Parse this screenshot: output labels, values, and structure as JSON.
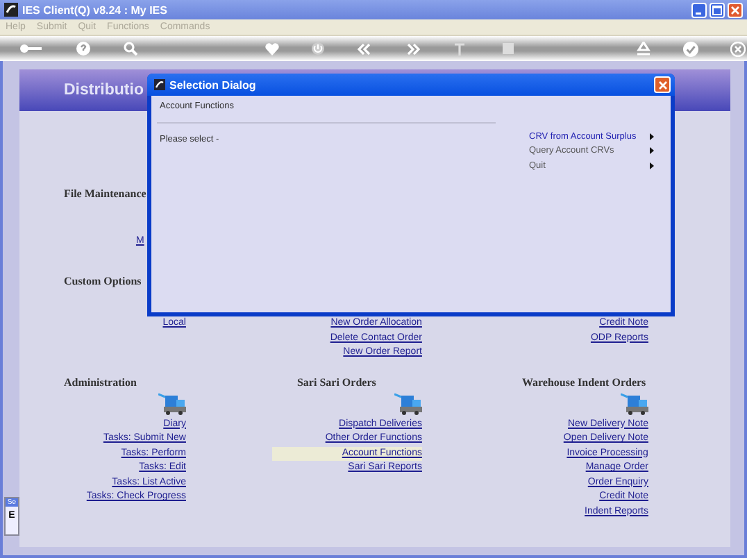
{
  "window": {
    "title": "IES Client(Q) v8.24 : My IES"
  },
  "menu": [
    {
      "label": "Help",
      "disabled": true
    },
    {
      "label": "Submit",
      "disabled": true
    },
    {
      "label": "Quit",
      "disabled": true
    },
    {
      "label": "Functions",
      "disabled": true
    },
    {
      "label": "Commands",
      "disabled": true
    }
  ],
  "page": {
    "title": "Distributio",
    "side_tab": {
      "header": "Se",
      "label": "E"
    }
  },
  "file_maintenance": {
    "heading": "File Maintenance",
    "links": [
      "M"
    ]
  },
  "custom_options": {
    "heading": "Custom Options",
    "columns": [
      [
        "Local"
      ],
      [
        "New Order Allocation",
        "Delete Contact Order",
        "New Order Report"
      ],
      [
        "Credit Note",
        "ODP Reports"
      ]
    ]
  },
  "groups": [
    {
      "heading": "Administration",
      "links": [
        {
          "label": "Diary",
          "selected": false
        },
        {
          "label": "Tasks: Submit New",
          "selected": false
        },
        {
          "label": "Tasks: Perform",
          "selected": false
        },
        {
          "label": "Tasks: Edit",
          "selected": false
        },
        {
          "label": "Tasks: List Active",
          "selected": false
        },
        {
          "label": "Tasks: Check Progress",
          "selected": false
        }
      ]
    },
    {
      "heading": "Sari Sari Orders",
      "links": [
        {
          "label": "Dispatch Deliveries",
          "selected": false
        },
        {
          "label": "Other Order Functions",
          "selected": false
        },
        {
          "label": "Account Functions",
          "selected": true
        },
        {
          "label": "Sari Sari Reports",
          "selected": false
        }
      ]
    },
    {
      "heading": "Warehouse Indent Orders",
      "links": [
        {
          "label": "New Delivery Note",
          "selected": false
        },
        {
          "label": "Open Delivery Note",
          "selected": false
        },
        {
          "label": "Invoice Processing",
          "selected": false
        },
        {
          "label": "Manage Order",
          "selected": false
        },
        {
          "label": "Order Enquiry",
          "selected": false
        },
        {
          "label": "Credit Note",
          "selected": false
        },
        {
          "label": "Indent Reports",
          "selected": false
        }
      ]
    }
  ],
  "dialog": {
    "title": "Selection Dialog",
    "subtitle": "Account Functions",
    "prompt": "Please select -",
    "options": [
      {
        "label": "CRV from Account Surplus",
        "selected": true
      },
      {
        "label": "Query Account CRVs",
        "selected": false
      },
      {
        "label": "Quit",
        "selected": false
      }
    ]
  }
}
